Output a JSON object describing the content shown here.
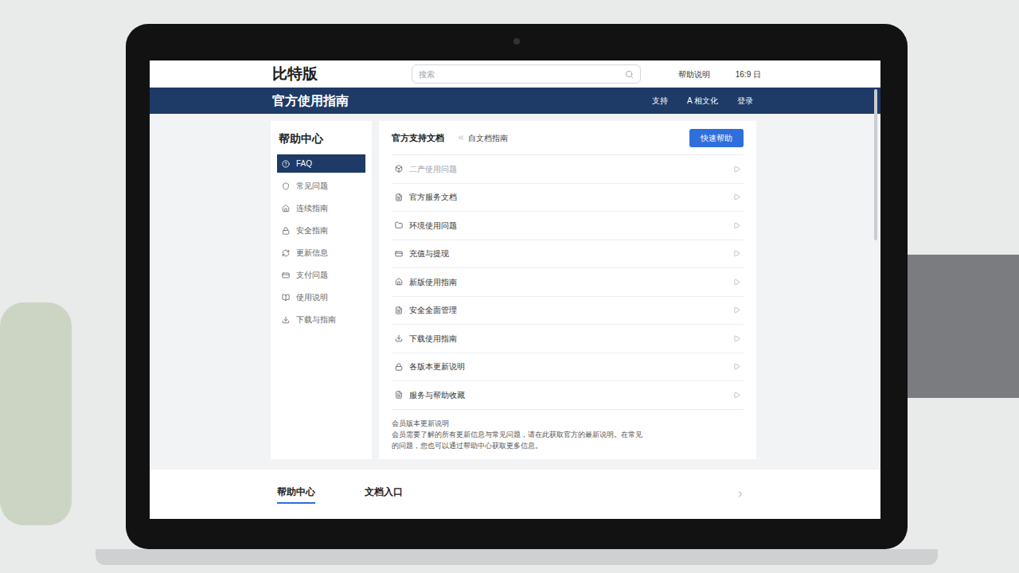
{
  "header": {
    "logo": "比特版",
    "search_placeholder": "搜索",
    "links": [
      "帮助说明",
      "16:9 日"
    ]
  },
  "nav_bar": {
    "title": "官方使用指南",
    "links": [
      "支持",
      "A 相文化",
      "登录"
    ]
  },
  "sidebar": {
    "title": "帮助中心",
    "items": [
      {
        "label": "FAQ",
        "selected": true
      },
      {
        "label": "常见问题",
        "selected": false
      },
      {
        "label": "连续指南",
        "selected": false
      },
      {
        "label": "安全指南",
        "selected": false
      },
      {
        "label": "更新信息",
        "selected": false
      },
      {
        "label": "支付问题",
        "selected": false
      },
      {
        "label": "使用说明",
        "selected": false
      },
      {
        "label": "下载与指南",
        "selected": false
      }
    ]
  },
  "content": {
    "title": "官方支持文档",
    "breadcrumb": "自文档指南",
    "button": "快速帮助",
    "rows": [
      {
        "label": "二产使用问题",
        "disabled": true
      },
      {
        "label": "官方服务文档",
        "disabled": false
      },
      {
        "label": "环境使用问题",
        "disabled": false
      },
      {
        "label": "充值与提现",
        "disabled": false
      },
      {
        "label": "新版使用指南",
        "disabled": false
      },
      {
        "label": "安全全面管理",
        "disabled": false
      },
      {
        "label": "下载使用指南",
        "disabled": false
      },
      {
        "label": "各版本更新说明",
        "disabled": false
      },
      {
        "label": "服务与帮助收藏",
        "disabled": false
      }
    ],
    "note": {
      "title": "会员版本更新说明",
      "lines": [
        "会员需要了解的所有更新信息与常见问题，请在此获取官方的最新说明。在常见",
        "的问题，您也可以通过帮助中心获取更多信息。"
      ]
    }
  },
  "bottom_tabs": [
    {
      "label": "帮助中心",
      "selected": true
    },
    {
      "label": "文档入口",
      "selected": false
    }
  ]
}
